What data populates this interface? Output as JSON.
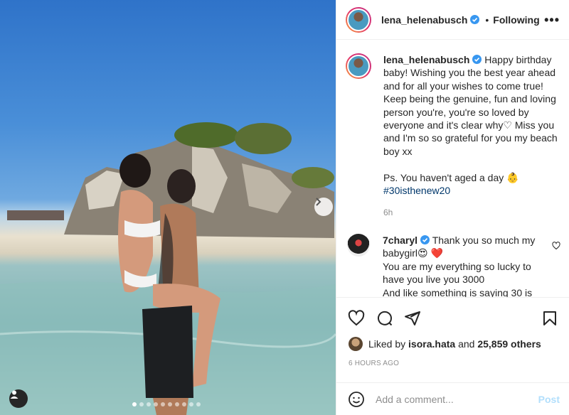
{
  "post": {
    "username": "lena_helenabusch",
    "follow_separator": "•",
    "follow_status": "Following",
    "more_label": "•••",
    "caption_main": "Happy birthday baby! Wishing you the best year ahead and for all your wishes to come true! Keep being the genuine, fun and loving person you're, you're so loved by everyone and it's clear why♡  Miss you and I'm so so grateful for you my beach boy xx",
    "caption_ps": "Ps. You haven't aged a day 👶",
    "hashtag": "#30isthenew20",
    "time": "6h",
    "carousel_count": 10,
    "carousel_active": 0
  },
  "comment": {
    "username": "7charyl",
    "text_1": "Thank you so much my babygirl😍 ❤️",
    "text_2": "You are my everything so lucky to have you live you 3000",
    "text_3": "And like something is saying 30 is"
  },
  "likes": {
    "prefix": "Liked by",
    "user": "isora.hata",
    "conj": "and",
    "count": "25,859 others"
  },
  "timestamp": "6 HOURS AGO",
  "add_comment": {
    "placeholder": "Add a comment...",
    "post_label": "Post"
  },
  "colors": {
    "accent_link": "#00376b",
    "verified_blue": "#3897f0",
    "post_disabled": "#b2dffc",
    "heart_red": "#ed4956"
  },
  "icons": {
    "like": "heart-icon",
    "comment": "comment-icon",
    "share": "send-icon",
    "save": "bookmark-icon",
    "emoji": "smiley-icon"
  }
}
